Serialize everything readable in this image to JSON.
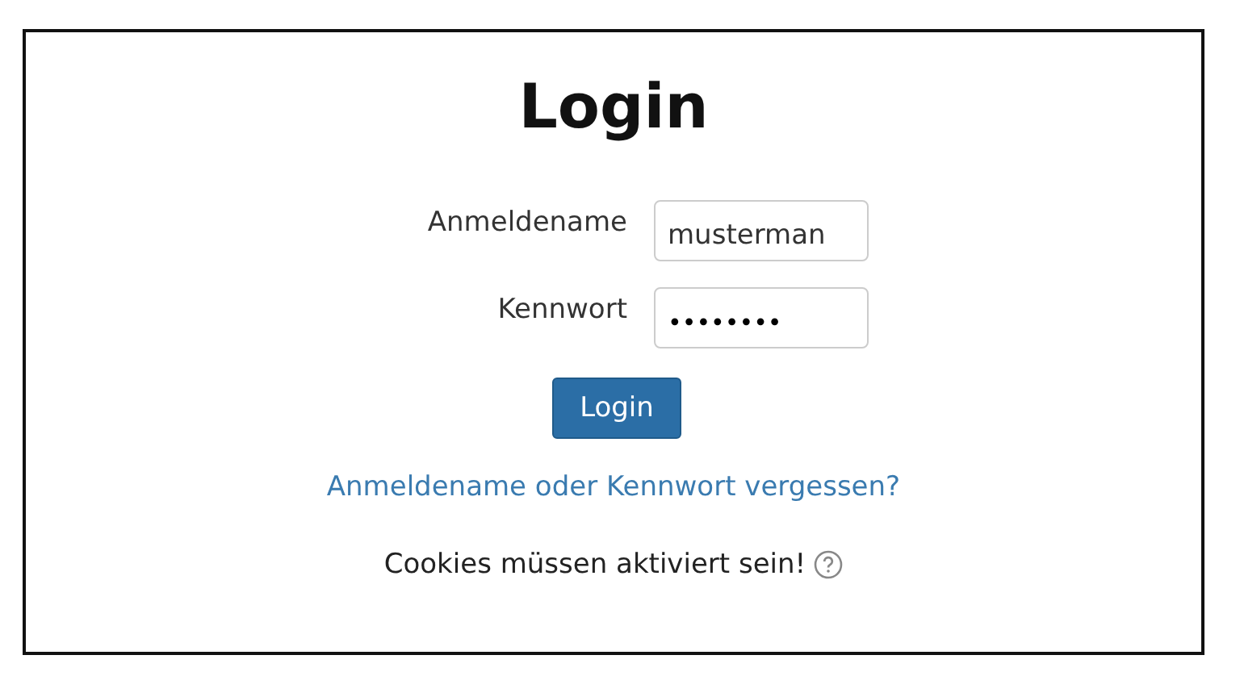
{
  "title": "Login",
  "fields": [
    {
      "label": "Anmeldename",
      "value": "musterman",
      "kind": "text"
    },
    {
      "label": "Kennwort",
      "value": "••••••••",
      "kind": "password"
    }
  ],
  "submit": "Login",
  "forgot_link": "Anmeldename oder Kennwort vergessen?",
  "cookie_notice": "Cookies müssen aktiviert sein!"
}
